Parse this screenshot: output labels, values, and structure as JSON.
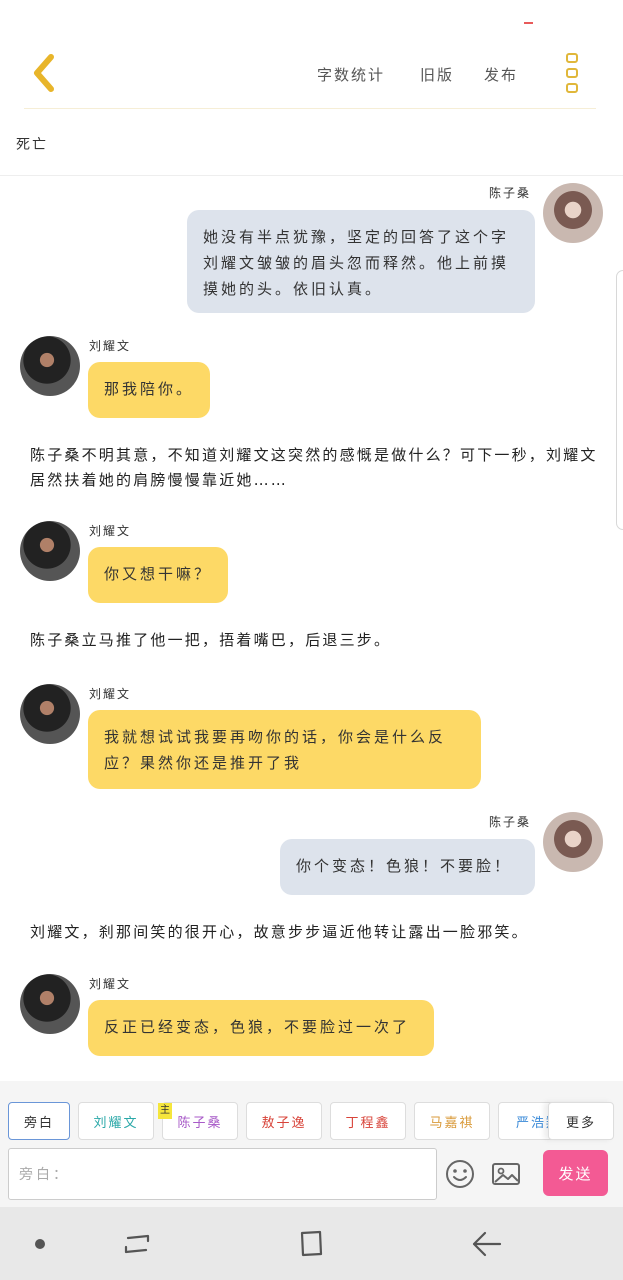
{
  "header": {
    "back_icon": "chevron-left-icon",
    "word_count": "字数统计",
    "old_version": "旧版",
    "publish": "发布",
    "more_icon": "more-vertical-icon"
  },
  "chapter": {
    "title": "死亡"
  },
  "messages": [
    {
      "speaker": "陈子桑",
      "text": "她没有半点犹豫，坚定的回答了这个字\n刘耀文皱皱的眉头忽而释然。他上前摸\n摸她的头。依旧认真。"
    },
    {
      "speaker": "刘耀文",
      "text": "那我陪你。"
    },
    {
      "narration": "陈子桑不明其意，不知道刘耀文这突然的感慨是做什么？可下一秒，刘耀文居然扶着她的肩膀慢慢靠近她……"
    },
    {
      "speaker": "刘耀文",
      "text": "你又想干嘛？"
    },
    {
      "narration": "陈子桑立马推了他一把，捂着嘴巴，后退三步。"
    },
    {
      "speaker": "刘耀文",
      "text": "我就想试试我要再吻你的话，你会是什么反\n应？果然你还是推开了我"
    },
    {
      "speaker": "陈子桑",
      "text": "你个变态！色狼！不要脸！"
    },
    {
      "narration": "刘耀文，刹那间笑的很开心，故意步步逼近他转让露出一脸邪笑。"
    },
    {
      "speaker": "刘耀文",
      "text": "反正已经变态，色狼，不要脸过一次了"
    }
  ],
  "roles": {
    "narrator": "旁白",
    "main_badge": "主",
    "items": [
      {
        "label": "刘耀文",
        "color": "#2aa8a8"
      },
      {
        "label": "陈子桑",
        "color": "#a85ac8"
      },
      {
        "label": "敖子逸",
        "color": "#d8443a"
      },
      {
        "label": "丁程鑫",
        "color": "#d8443a"
      },
      {
        "label": "马嘉祺",
        "color": "#d99a3a"
      },
      {
        "label": "严浩翔",
        "color": "#3a8ad8"
      }
    ],
    "more": "更多"
  },
  "composer": {
    "placeholder": "旁白：",
    "emoji_icon": "emoji-icon",
    "image_icon": "image-icon",
    "send": "发送",
    "send_color": "#f35a94"
  },
  "system_nav": {
    "dot_icon": "dot-icon",
    "recents_icon": "recent-apps-icon",
    "home_icon": "home-icon",
    "back_icon": "back-arrow-icon"
  }
}
